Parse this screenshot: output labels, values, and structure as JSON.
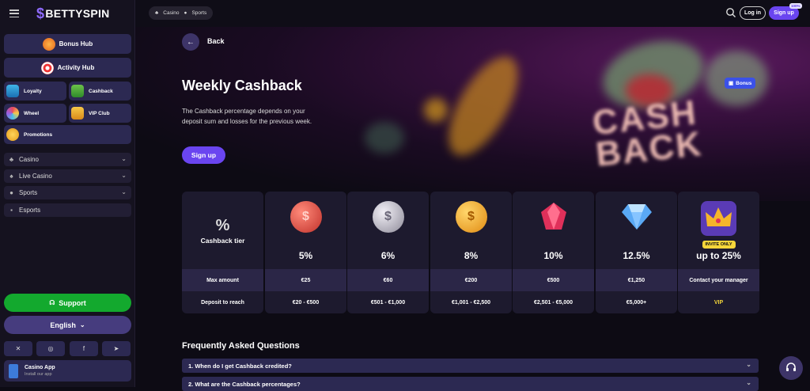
{
  "brand": {
    "name": "BETTYSPIN",
    "accent": "#6a45f0"
  },
  "sidebar": {
    "hubs": [
      {
        "label": "Bonus Hub",
        "icon": "gift-icon"
      },
      {
        "label": "Activity Hub",
        "icon": "target-icon"
      }
    ],
    "tiles": [
      {
        "label": "Loyalty",
        "icon": "shield-icon"
      },
      {
        "label": "Cashback",
        "icon": "money-icon"
      },
      {
        "label": "Wheel",
        "icon": "wheel-icon"
      },
      {
        "label": "VIP Club",
        "icon": "crown-icon"
      },
      {
        "label": "Promotions",
        "icon": "coin-icon"
      }
    ],
    "nav": [
      {
        "label": "Casino",
        "icon": "cherries-icon",
        "expandable": true
      },
      {
        "label": "Live Casino",
        "icon": "cards-icon",
        "expandable": true
      },
      {
        "label": "Sports",
        "icon": "ball-icon",
        "expandable": true
      },
      {
        "label": "Esports",
        "icon": "gamepad-icon",
        "expandable": false
      }
    ],
    "support_label": "Support",
    "language": "English",
    "social": [
      "x-icon",
      "instagram-icon",
      "facebook-icon",
      "telegram-icon"
    ],
    "app": {
      "title": "Casino App",
      "subtitle": "Install our app"
    }
  },
  "topbar": {
    "pills": [
      "Casino",
      "Sports"
    ],
    "login": "Log in",
    "signup": "Sign up",
    "signup_badge": "100%"
  },
  "hero": {
    "back": "Back",
    "title": "Weekly Cashback",
    "description": "The Cashback percentage depends on your deposit sum and losses for the previous week.",
    "signup": "Sign up",
    "bonus_tag": "Bonus",
    "art_text": [
      "CASH",
      "BACK"
    ]
  },
  "tiers": {
    "header_symbol": "%",
    "header_label": "Cashback tier",
    "row_labels": [
      "Max amount",
      "Deposit to reach"
    ],
    "items": [
      {
        "pct": "5%",
        "max": "€25",
        "deposit": "€20 - €500",
        "icon": "coin-red-icon",
        "color": "#d8473c"
      },
      {
        "pct": "6%",
        "max": "€60",
        "deposit": "€501 - €1,000",
        "icon": "coin-silver-icon",
        "color": "#b9b5c4"
      },
      {
        "pct": "8%",
        "max": "€200",
        "deposit": "€1,001 - €2,500",
        "icon": "coin-gold-icon",
        "color": "#f0a62a"
      },
      {
        "pct": "10%",
        "max": "€500",
        "deposit": "€2,501 - €5,000",
        "icon": "ruby-icon",
        "color": "#e0305a"
      },
      {
        "pct": "12.5%",
        "max": "€1,250",
        "deposit": "€5,000+",
        "icon": "diamond-icon",
        "color": "#5aa9f5"
      },
      {
        "pct": "up to 25%",
        "max": "Contact your manager",
        "deposit": "VIP",
        "icon": "crown-icon",
        "color": "#5a3bb5",
        "badge": "INVITE ONLY"
      }
    ]
  },
  "faq": {
    "title": "Frequently Asked Questions",
    "items": [
      "1.  When do I get Cashback credited?",
      "2.  What are the Cashback percentages?"
    ]
  }
}
